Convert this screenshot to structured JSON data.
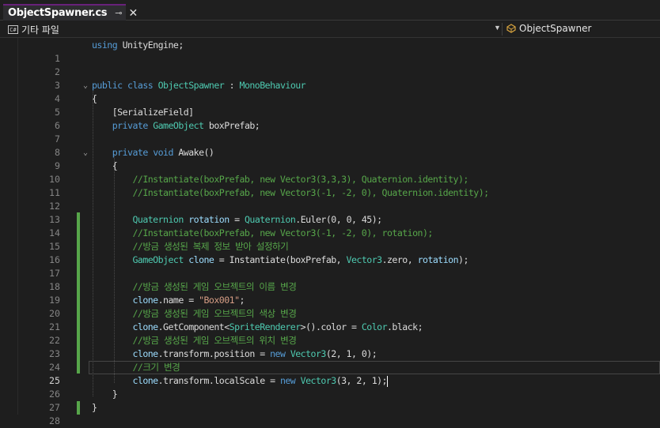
{
  "tab": {
    "title": "ObjectSpawner.cs",
    "pin_glyph": "⊸",
    "close_glyph": "✕"
  },
  "navbar": {
    "project_icon_text": "C#",
    "project": "기타 파일",
    "member": "ObjectSpawner"
  },
  "editor": {
    "current_line": 25,
    "lines": [
      {
        "n": "",
        "code": "using UnityEngine;"
      },
      {
        "n": "1",
        "code": ""
      },
      {
        "n": "2",
        "code": ""
      },
      {
        "n": "3",
        "code": "public class ObjectSpawner : MonoBehaviour"
      },
      {
        "n": "4",
        "code": "{"
      },
      {
        "n": "5",
        "code": "    [SerializeField]"
      },
      {
        "n": "6",
        "code": "    private GameObject boxPrefab;"
      },
      {
        "n": "7",
        "code": ""
      },
      {
        "n": "8",
        "code": "    private void Awake()"
      },
      {
        "n": "9",
        "code": "    {"
      },
      {
        "n": "10",
        "code": "        //Instantiate(boxPrefab, new Vector3(3,3,3), Quaternion.identity);"
      },
      {
        "n": "11",
        "code": "        //Instantiate(boxPrefab, new Vector3(-1, -2, 0), Quaternion.identity);"
      },
      {
        "n": "12",
        "code": ""
      },
      {
        "n": "13",
        "code": "        Quaternion rotation = Quaternion.Euler(0, 0, 45);"
      },
      {
        "n": "14",
        "code": "        //Instantiate(boxPrefab, new Vector3(-1, -2, 0), rotation);"
      },
      {
        "n": "15",
        "code": "        //방금 생성된 복제 정보 받아 설정하기"
      },
      {
        "n": "16",
        "code": "        GameObject clone = Instantiate(boxPrefab, Vector3.zero, rotation);"
      },
      {
        "n": "17",
        "code": ""
      },
      {
        "n": "18",
        "code": "        //방금 생성된 게임 오브젝트의 이름 변경"
      },
      {
        "n": "19",
        "code": "        clone.name = \"Box001\";"
      },
      {
        "n": "20",
        "code": "        //방금 생성된 게임 오브젝트의 색상 변경"
      },
      {
        "n": "21",
        "code": "        clone.GetComponent<SpriteRenderer>().color = Color.black;"
      },
      {
        "n": "22",
        "code": "        //방금 생성된 게임 오브젝트의 위치 변경"
      },
      {
        "n": "23",
        "code": "        clone.transform.position = new Vector3(2, 1, 0);"
      },
      {
        "n": "24",
        "code": "        //크기 변경"
      },
      {
        "n": "25",
        "code": "        clone.transform.localScale = new Vector3(3, 2, 1);"
      },
      {
        "n": "26",
        "code": "    }"
      },
      {
        "n": "27",
        "code": "}"
      },
      {
        "n": "28",
        "code": ""
      }
    ]
  },
  "colors": {
    "background": "#1e1e1e",
    "keyword": "#569cd6",
    "type": "#4ec9b0",
    "comment": "#57a64a",
    "string": "#d69d85",
    "local": "#9cdcfe",
    "change_marker": "#57a64a",
    "tab_accent": "#68217a"
  }
}
